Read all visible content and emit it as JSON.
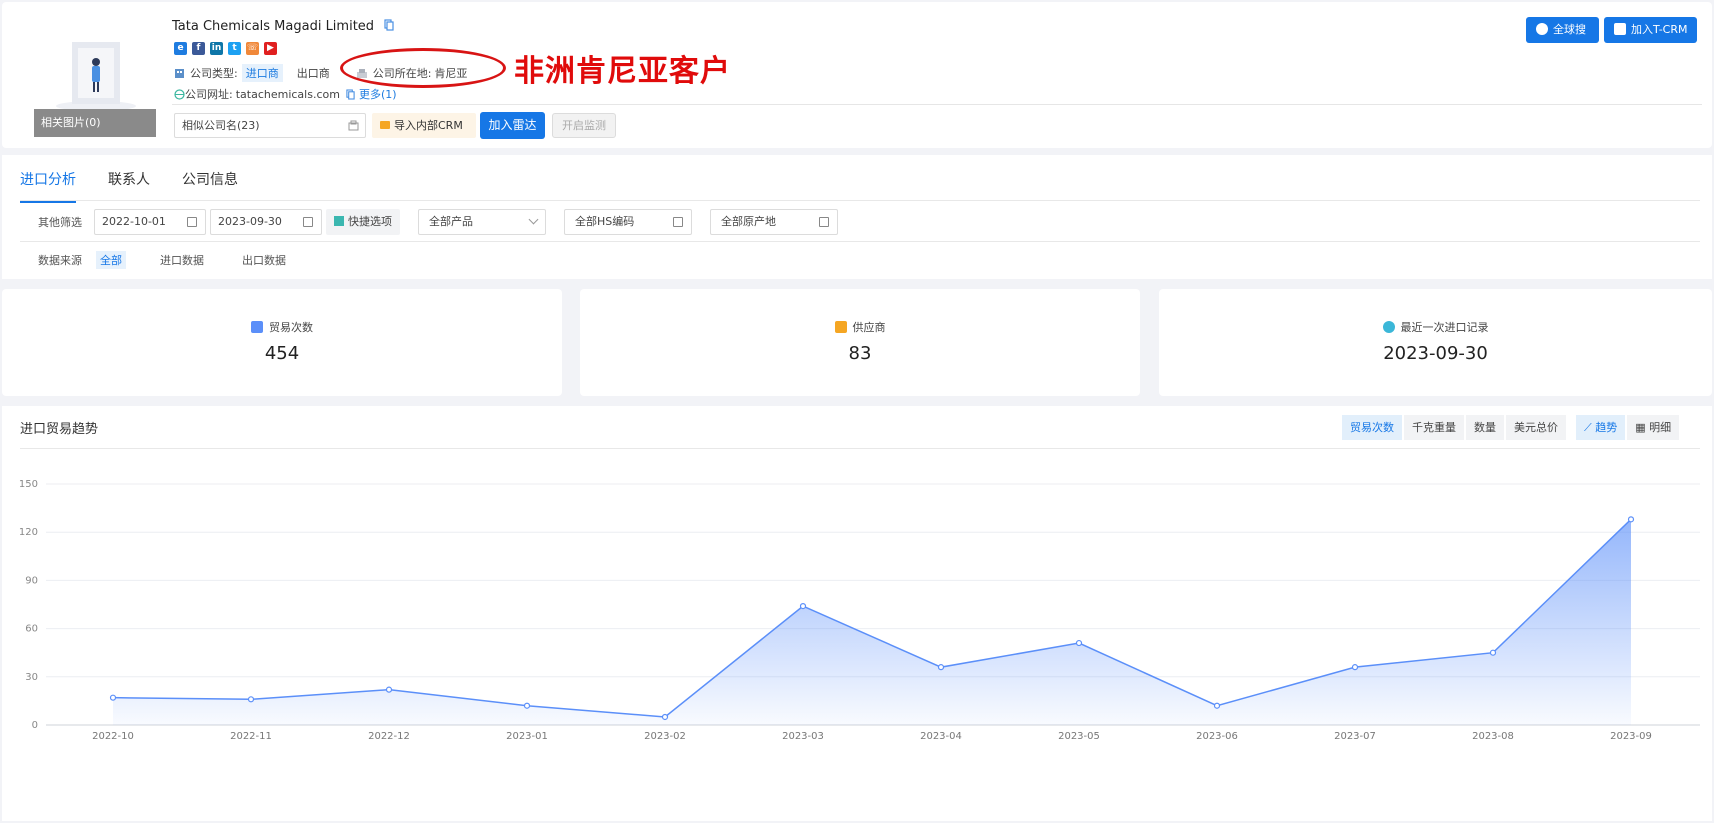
{
  "header": {
    "company_name": "Tata Chemicals Magadi Limited",
    "photos_label": "相关图片(0)",
    "company_type_label": "公司类型:",
    "company_type_active": "进口商",
    "company_type_other": "出口商",
    "location_label": "公司所在地:",
    "location_value": "肯尼亚",
    "website_label": "公司网址:",
    "website_value": "tatachemicals.com",
    "more_link": "更多(1)",
    "annotation_text": "非洲肯尼亚客户",
    "similar_input": "相似公司名(23)",
    "import_crm_button": "导入内部CRM",
    "add_radar_button": "加入雷达",
    "monitor_button": "开启监测",
    "global_search_button": "全球搜",
    "add_tcrm_button": "加入T-CRM",
    "social_icons": [
      "ie-icon",
      "facebook-icon",
      "linkedin-icon",
      "twitter-icon",
      "phone-icon",
      "youtube-icon"
    ]
  },
  "tabs": [
    {
      "label": "进口分析",
      "active": true
    },
    {
      "label": "联系人",
      "active": false
    },
    {
      "label": "公司信息",
      "active": false
    }
  ],
  "filters": {
    "label": "其他筛选",
    "start_date": "2022-10-01",
    "end_date": "2023-09-30",
    "quick_options": "快捷选项",
    "product": "全部产品",
    "hs_code": "全部HS编码",
    "origin": "全部原产地"
  },
  "source": {
    "label": "数据来源",
    "options": [
      "全部",
      "进口数据",
      "出口数据"
    ],
    "active": "全部"
  },
  "stats": [
    {
      "label": "贸易次数",
      "value": "454",
      "color": "#5b8ff9"
    },
    {
      "label": "供应商",
      "value": "83",
      "color": "#f5a623"
    },
    {
      "label": "最近一次进口记录",
      "value": "2023-09-30",
      "color": "#3bb7d8"
    }
  ],
  "trend": {
    "title": "进口贸易趋势",
    "metric_toggles": [
      "贸易次数",
      "千克重量",
      "数量",
      "美元总价"
    ],
    "view_toggles": [
      "趋势",
      "明细"
    ],
    "active_metric": "贸易次数",
    "active_view": "趋势"
  },
  "chart_data": {
    "type": "area",
    "categories": [
      "2022-10",
      "2022-11",
      "2022-12",
      "2023-01",
      "2023-02",
      "2023-03",
      "2023-04",
      "2023-05",
      "2023-06",
      "2023-07",
      "2023-08",
      "2023-09"
    ],
    "values": [
      17,
      16,
      22,
      12,
      5,
      74,
      36,
      51,
      12,
      36,
      45,
      128
    ],
    "ylim": [
      0,
      150
    ],
    "yticks": [
      0,
      30,
      60,
      90,
      120,
      150
    ],
    "grid": true,
    "line_color": "#5b8ff9",
    "title": "",
    "xlabel": "",
    "ylabel": ""
  }
}
